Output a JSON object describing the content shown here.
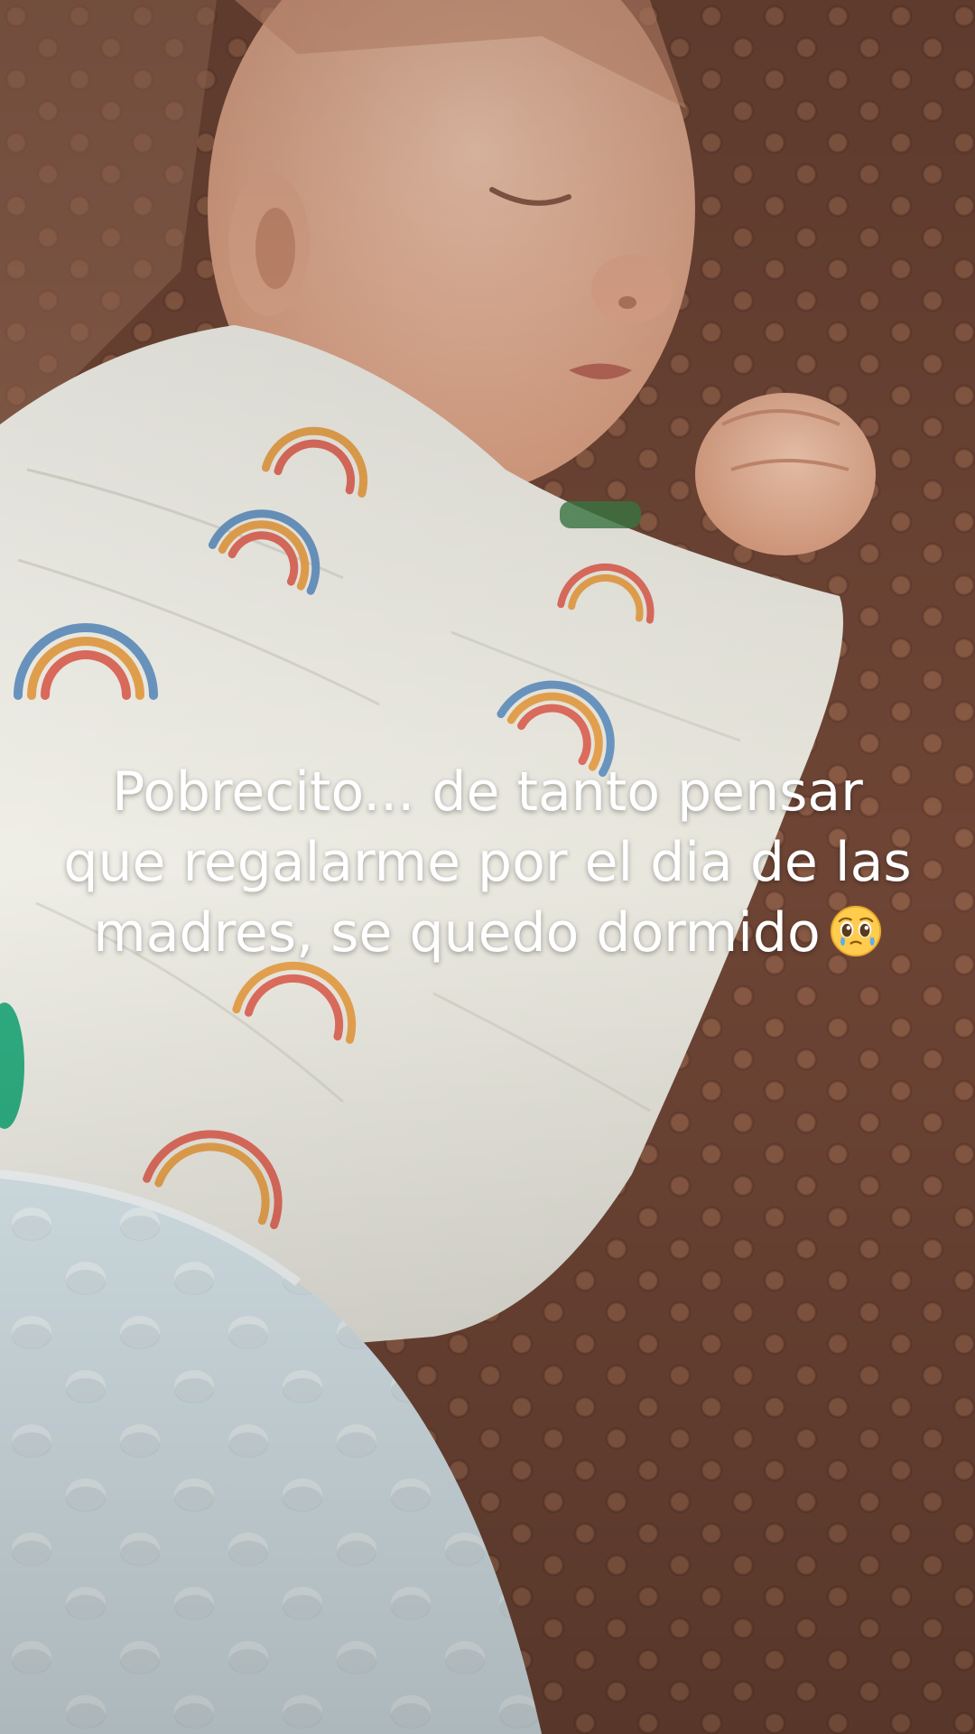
{
  "scene": {
    "subject": "sleeping-baby",
    "colors": {
      "blanket_brown": "#7a4f3a",
      "swaddle_white": "#efeee6",
      "pillow_blue": "#d6e6ec",
      "skin": "#e8b59a",
      "pacifier_green": "#2fae82"
    }
  },
  "caption": {
    "line1": "Pobrecito... de tanto pensar",
    "line2": "que regalarme por el dia de las",
    "line3": "madres, se quedo dormido",
    "emoji": "pleading-face-with-tears"
  }
}
